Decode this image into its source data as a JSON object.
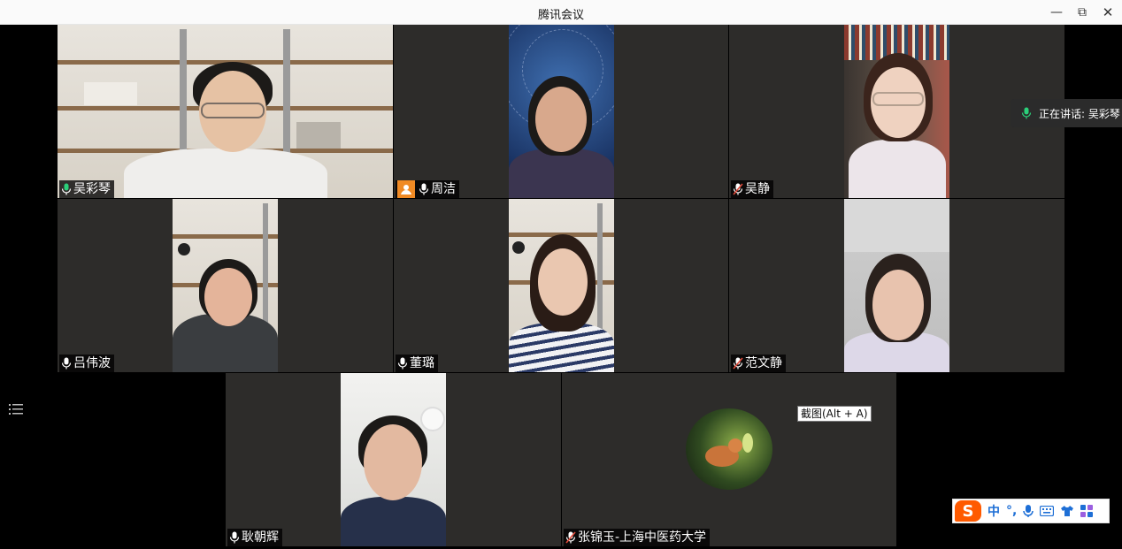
{
  "window": {
    "title": "腾讯会议",
    "minimize": "—",
    "restore": "⧉",
    "close": "✕"
  },
  "speaking_indicator": {
    "text": "正在讲话: 吴彩琴"
  },
  "tooltip": {
    "text": "截图(Alt + A)"
  },
  "ime": {
    "logo": "S",
    "mode": "中",
    "punct": "°,",
    "icons": [
      "mic-icon",
      "keyboard-icon",
      "skin-icon",
      "toolbox-icon"
    ]
  },
  "participants": [
    {
      "name": "吴彩琴",
      "mic": "on",
      "active": true
    },
    {
      "name": "周洁",
      "mic": "on",
      "host": true
    },
    {
      "name": "吴静",
      "mic": "muted"
    },
    {
      "name": "吕伟波",
      "mic": "on"
    },
    {
      "name": "董璐",
      "mic": "on"
    },
    {
      "name": "范文静",
      "mic": "muted"
    },
    {
      "name": "耿朝辉",
      "mic": "on"
    },
    {
      "name": "张锦玉-上海中医药大学",
      "mic": "muted",
      "video": "off"
    }
  ],
  "colors": {
    "active_border": "#2bd07a",
    "mic_active": "#2bd07a",
    "mic_muted": "#e04a3a",
    "host_badge": "#f08a24"
  }
}
